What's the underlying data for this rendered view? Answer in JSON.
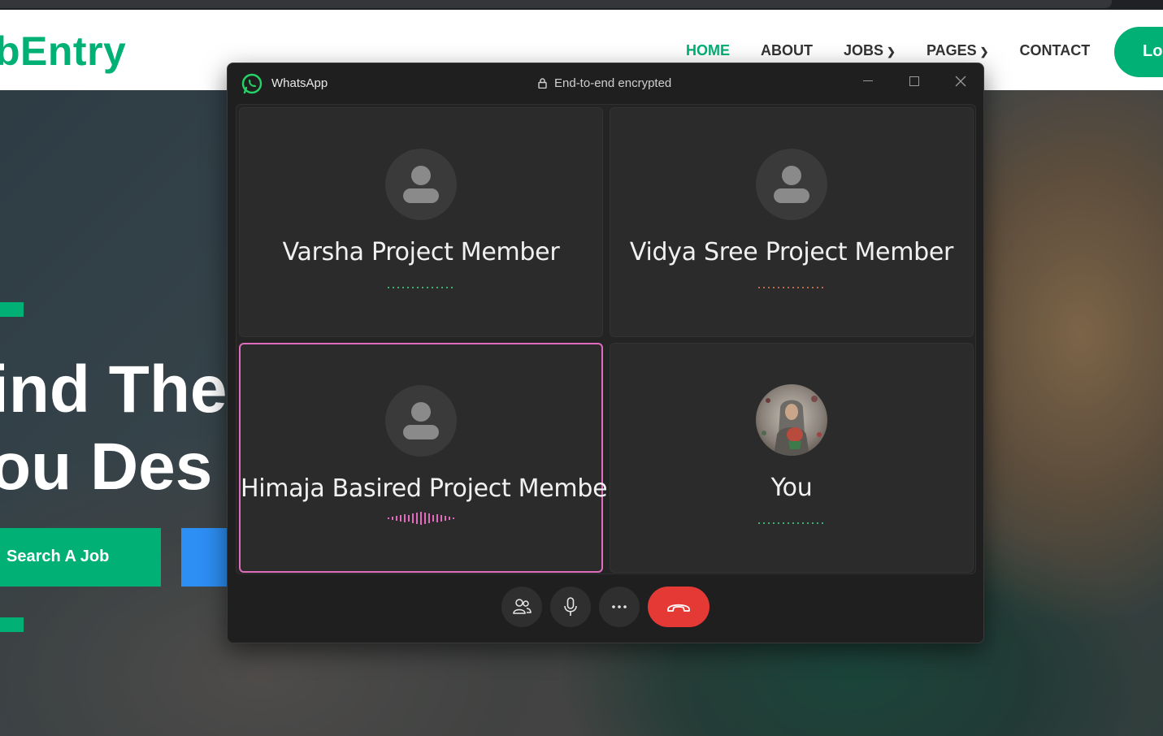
{
  "website": {
    "logo": "bEntry",
    "menu": [
      {
        "label": "HOME",
        "active": true
      },
      {
        "label": "ABOUT"
      },
      {
        "label": "JOBS",
        "caret": true
      },
      {
        "label": "PAGES",
        "caret": true
      },
      {
        "label": "CONTACT"
      }
    ],
    "login_label": "Lo",
    "hero_line1": "ind The",
    "hero_line2": "ou Des",
    "search_button": "Search A Job",
    "accent_color": "#00b074"
  },
  "whatsapp": {
    "app_name": "WhatsApp",
    "encryption_label": "End-to-end encrypted",
    "participants": [
      {
        "name": "Varsha Project Member",
        "avatar": "default-avatar-icon",
        "indicator": "dots",
        "indicator_color": "#3ddc84"
      },
      {
        "name": "Vidya Sree Project Member",
        "avatar": "default-avatar-icon",
        "indicator": "dots",
        "indicator_color": "#e67e5c"
      },
      {
        "name": "Himaja Basired Project Member",
        "avatar": "default-avatar-icon",
        "indicator": "waveform",
        "indicator_color": "#e06cbd",
        "speaking": true
      },
      {
        "name": "You",
        "avatar": "profile-photo",
        "indicator": "dots",
        "indicator_color": "#3ddc84"
      }
    ],
    "controls": [
      "participants-icon",
      "microphone-icon",
      "more-icon",
      "end-call-icon"
    ],
    "end_call_color": "#e53935"
  }
}
